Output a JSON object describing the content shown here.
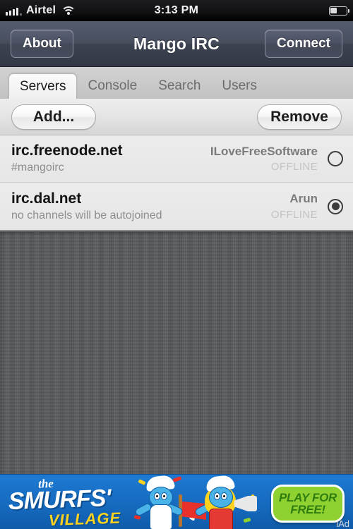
{
  "status_bar": {
    "carrier": "Airtel",
    "signal_icon": "signal-bars-icon",
    "signal_bars_filled": 4,
    "wifi_icon": "wifi-icon",
    "time": "3:13 PM",
    "battery_icon": "battery-icon",
    "battery_percent": 40
  },
  "navbar": {
    "left_button": "About",
    "title": "Mango IRC",
    "right_button": "Connect"
  },
  "tabs": [
    {
      "label": "Servers",
      "active": true
    },
    {
      "label": "Console",
      "active": false
    },
    {
      "label": "Search",
      "active": false
    },
    {
      "label": "Users",
      "active": false
    }
  ],
  "toolbar": {
    "add_label": "Add...",
    "remove_label": "Remove"
  },
  "servers": [
    {
      "name": "irc.freenode.net",
      "channels": "#mangoirc",
      "nick": "ILoveFreeSoftware",
      "status": "OFFLINE",
      "selected": false
    },
    {
      "name": "irc.dal.net",
      "channels": "no channels will be autojoined",
      "nick": "Arun",
      "status": "OFFLINE",
      "selected": true
    }
  ],
  "ad": {
    "the": "the",
    "title": "SMURFS'",
    "subtitle": "VILLAGE",
    "cta_line1": "PLAY FOR",
    "cta_line2": "FREE!",
    "network_label": "iAd"
  },
  "colors": {
    "navbar": "#474e5e",
    "tab_active_bg": "#fbfbfb",
    "row_bg": "#e9e9e9",
    "linen": "#5a5c60",
    "ad_blue": "#1570c6",
    "ad_green": "#8fd131",
    "ad_yellow": "#ffd21e"
  }
}
